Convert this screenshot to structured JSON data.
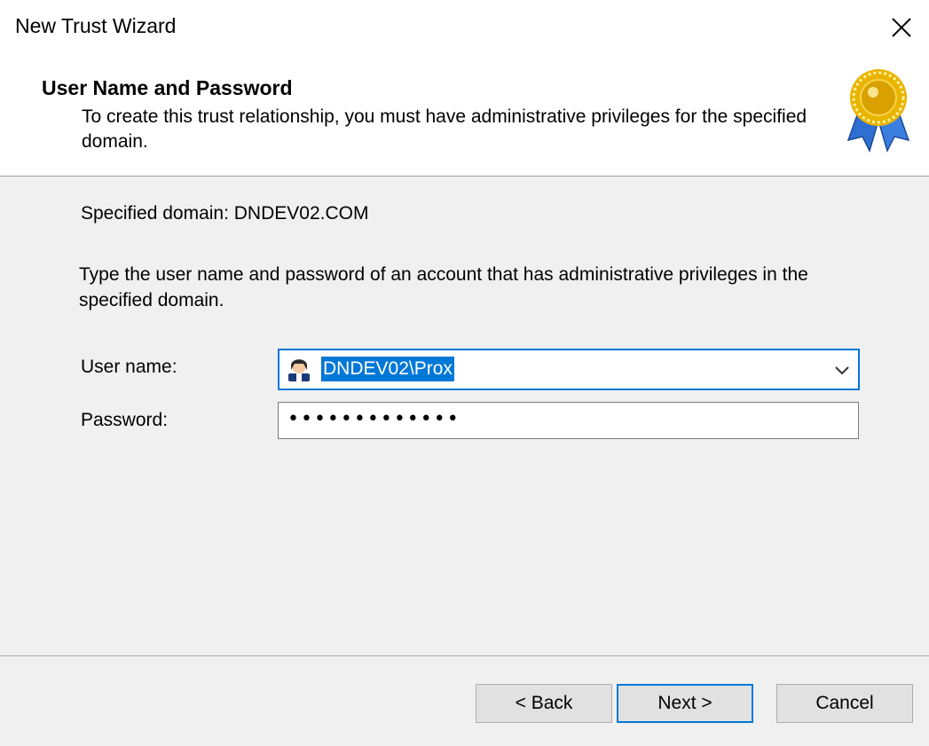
{
  "window": {
    "title": "New Trust Wizard",
    "close_icon": "close-icon"
  },
  "header": {
    "title": "User Name and Password",
    "subtitle": "To create this trust relationship, you must have administrative privileges for the specified domain.",
    "badge_icon": "award-ribbon-icon"
  },
  "content": {
    "domain_line": "Specified domain: DNDEV02.COM",
    "instructions": "Type the user name and password of an account that has administrative privileges in the specified domain.",
    "username": {
      "label": "User name:",
      "value": "DNDEV02\\Prox",
      "icon": "user-icon"
    },
    "password": {
      "label": "Password:",
      "masked_value": "•••••••••••••"
    }
  },
  "buttons": {
    "back": "< Back",
    "next": "Next >",
    "cancel": "Cancel"
  },
  "colors": {
    "accent": "#0078d7",
    "background": "#f0f0f0",
    "header_bg": "#ffffff"
  }
}
